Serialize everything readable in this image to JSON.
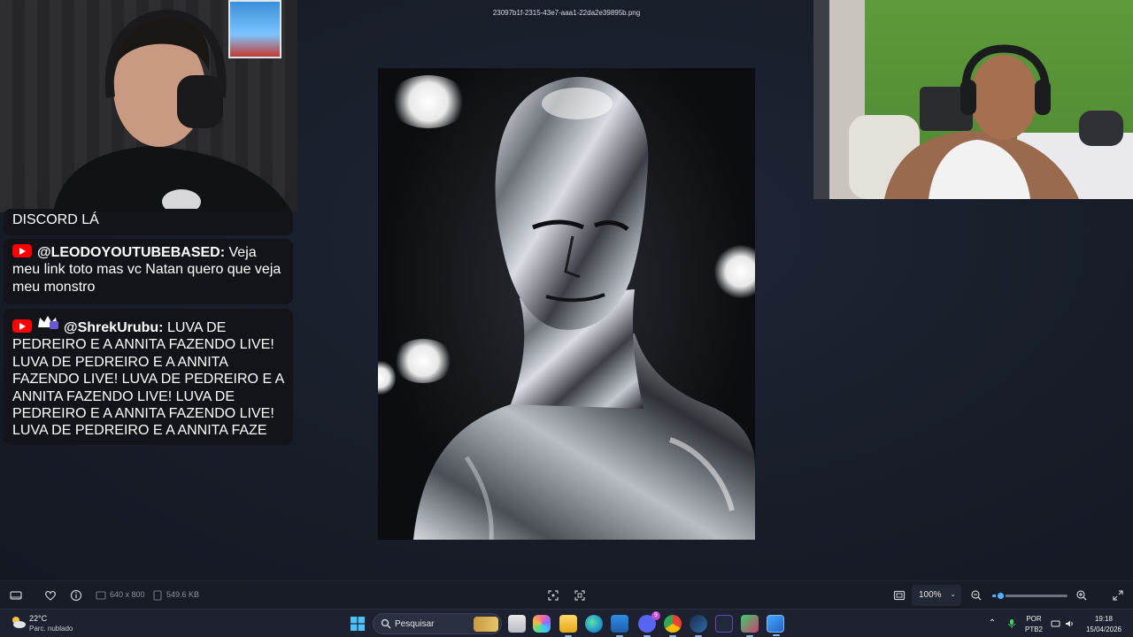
{
  "viewer": {
    "file_name": "23097b1f-2315-43e7-aaa1-22da2e39895b.png",
    "dimensions": "640 x 800",
    "file_size": "549.6 KB",
    "zoom_level": "100%",
    "zoom_slider_fraction": 0.1
  },
  "chat": {
    "fragment_text": "DISCORD LÁ",
    "messages": [
      {
        "platform_icon": "youtube-icon",
        "author": "@LEODOYOUTUBEBASED:",
        "text": "Veja meu link toto mas vc Natan quero que veja meu monstro"
      },
      {
        "platform_icon": "youtube-icon",
        "badge_icon": "member-crown-icon",
        "author": "@ShrekUrubu:",
        "text": "LUVA DE PEDREIRO E A ANNITA FAZENDO LIVE! LUVA DE PEDREIRO E A ANNITA FAZENDO LIVE! LUVA DE PEDREIRO E A ANNITA FAZENDO LIVE! LUVA DE PEDREIRO E A ANNITA FAZENDO LIVE! LUVA DE PEDREIRO E A ANNITA FAZE"
      }
    ]
  },
  "taskbar": {
    "weather_temp": "22°C",
    "weather_desc": "Parc. nublado",
    "search_placeholder": "Pesquisar",
    "language_top": "POR",
    "language_bottom": "PTB2",
    "time": "19:18",
    "date": "15/04/2026",
    "discord_badge": "9",
    "apps": [
      "start-icon",
      "search-icon",
      "file-explorer-icon",
      "copilot-icon",
      "folder-icon",
      "edge-icon",
      "photos-icon",
      "discord-icon",
      "chrome-icon",
      "steam-icon",
      "epic-icon",
      "game-icon",
      "photos-viewer-icon"
    ]
  },
  "colors": {
    "accent": "#4fb4ff",
    "youtube_red": "#ff0000",
    "chat_bg": "#121419",
    "toolbar_bg": "#181c26",
    "taskbar_bg": "#1e2230"
  }
}
